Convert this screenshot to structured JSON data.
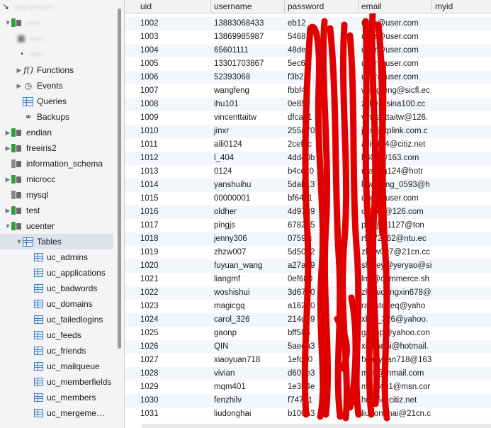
{
  "sidebar": {
    "items": [
      {
        "label": "Functions",
        "icon": "function-icon"
      },
      {
        "label": "Events",
        "icon": "clock-icon"
      },
      {
        "label": "Queries",
        "icon": "query-icon"
      },
      {
        "label": "Backups",
        "icon": "backup-icon"
      },
      {
        "label": "endian"
      },
      {
        "label": "freeiris2"
      },
      {
        "label": "information_schema"
      },
      {
        "label": "microcc"
      },
      {
        "label": "mysql"
      },
      {
        "label": "test"
      },
      {
        "label": "ucenter"
      },
      {
        "label": "Tables"
      }
    ],
    "tables": [
      "uc_admins",
      "uc_applications",
      "uc_badwords",
      "uc_domains",
      "uc_failedlogins",
      "uc_feeds",
      "uc_friends",
      "uc_mailqueue",
      "uc_memberfields",
      "uc_members",
      "uc_mergeme…"
    ]
  },
  "grid": {
    "columns": [
      "uid",
      "username",
      "password",
      "email",
      "myid"
    ],
    "rows": [
      [
        "1003",
        "13869985987",
        "5468",
        "user@user.com"
      ],
      [
        "1002",
        "13883068433",
        "eb12",
        "user@user.com"
      ],
      [
        "1003",
        "13869985987",
        "5468",
        "user@user.com"
      ],
      [
        "1004",
        "65601111",
        "48de",
        "user@user.com"
      ],
      [
        "1005",
        "13301703867",
        "5ec6",
        "user@user.com"
      ],
      [
        "1006",
        "52393068",
        "f3b2",
        "user@user.com"
      ],
      [
        "1007",
        "wangfeng",
        "fbbf4",
        "wangfeng@sicfl.ec"
      ],
      [
        "1008",
        "ihu101",
        "0e852",
        "zxhy@sina100.cc"
      ],
      [
        "1009",
        "vincenttaitw",
        "dfca01",
        "vincenttaitw@126."
      ],
      [
        "1010",
        "jinxr",
        "255a70",
        "jinxr@tplink.com.c"
      ],
      [
        "1011",
        "aili0124",
        "2cef6c",
        "aili0124@citiz.net"
      ],
      [
        "1012",
        "l_404",
        "4dd40b",
        "l-404@163.com"
      ],
      [
        "1013",
        "0124",
        "b4cc20",
        "meiling124@hotr"
      ],
      [
        "1014",
        "yanshuihu",
        "5dab13",
        "lewisking_0593@h"
      ],
      [
        "1015",
        "00000001",
        "bf6471",
        "user@user.com"
      ],
      [
        "1016",
        "oldher",
        "4d9789",
        "oldher@126.com"
      ],
      [
        "1017",
        "pingjs",
        "678235",
        "pingjs01127@ton"
      ],
      [
        "1018",
        "jenny306",
        "0759fc",
        "r9272062@ntu.ec"
      ],
      [
        "1019",
        "zhzw007",
        "5d5042",
        "zhzw007@21cn.cc"
      ],
      [
        "1020",
        "fuyuan_wang",
        "a27a79",
        "shirley@yeryao@si"
      ],
      [
        "1021",
        "liangmf",
        "0ef680",
        "lmf@commerce.sh"
      ],
      [
        "1022",
        "woshishui",
        "3d6750",
        "zhuaidongxin678@1"
      ],
      [
        "1023",
        "magicgq",
        "a16260",
        "rainstoneq@yaho"
      ],
      [
        "1024",
        "carol_326",
        "214d59",
        "xlyyj_326@yahoo."
      ],
      [
        "1025",
        "gaonp",
        "bff585",
        "gaonp@yahoo.con"
      ],
      [
        "1026",
        "QIN",
        "5aeda3",
        "xihuanni@hotmail."
      ],
      [
        "1027",
        "xiaoyuan718",
        "1efdb0",
        "fxiaoyuan718@163"
      ],
      [
        "1028",
        "vivian",
        "d609e3",
        "mini@mmail.com"
      ],
      [
        "1029",
        "mqm401",
        "1e384e",
        "mqm401@msn.cor"
      ],
      [
        "1030",
        "fenzhilv",
        "f747b1",
        "huifei@citiz.net"
      ],
      [
        "1031",
        "liudonghai",
        "b100a3",
        "liudonghai@21cn.c"
      ]
    ]
  },
  "colors": {
    "selection": "#dbe3ec",
    "scribble": "#e00000",
    "db_green": "#2e9e3a",
    "table_blue": "#3f7fc4"
  }
}
